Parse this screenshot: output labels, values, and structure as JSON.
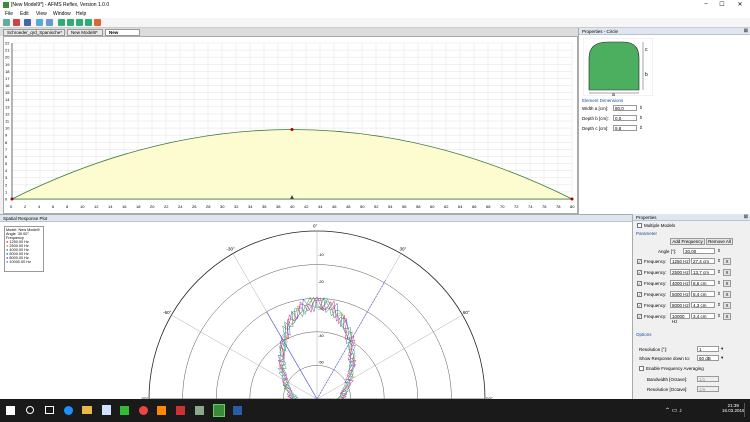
{
  "window": {
    "title": "[New Model9*] - AFMS Reflex, Version 1.0.0",
    "min": "–",
    "max": "☐",
    "close": "✕"
  },
  "menu": [
    "File",
    "Edit",
    "View",
    "Window",
    "Help"
  ],
  "tabs": [
    {
      "label": "Schroeder_qrd_Spanische*"
    },
    {
      "label": "New Model8*"
    },
    {
      "label": "New Model9*",
      "active": true
    }
  ],
  "model_view": {
    "y_ticks": [
      "22",
      "21",
      "20",
      "19",
      "18",
      "17",
      "16",
      "15",
      "14",
      "13",
      "12",
      "11",
      "10",
      "9",
      "8",
      "7",
      "6",
      "5",
      "4",
      "3",
      "2",
      "1",
      "0"
    ],
    "x_ticks": [
      "0",
      "2",
      "4",
      "6",
      "8",
      "10",
      "12",
      "14",
      "16",
      "18",
      "20",
      "22",
      "24",
      "26",
      "28",
      "30",
      "32",
      "34",
      "36",
      "38",
      "40",
      "42",
      "44",
      "46",
      "48",
      "50",
      "52",
      "54",
      "56",
      "58",
      "60",
      "62",
      "64",
      "66",
      "68",
      "70",
      "72",
      "74",
      "76",
      "78",
      "80"
    ],
    "arc_color": "#3a7a3a",
    "fill_color": "#fdfcd0"
  },
  "properties": {
    "header": "Properties - Circle",
    "dims": {
      "a": "a",
      "b": "b",
      "c": "c"
    },
    "section": "Element Dimensions",
    "fields": [
      {
        "label": "Width a [cm]:",
        "value": "80,0"
      },
      {
        "label": "Depth b [cm]:",
        "value": "0,0"
      },
      {
        "label": "Depth c [cm]:",
        "value": "9,8"
      }
    ],
    "shape_color": "#4caf60"
  },
  "spatial": {
    "header": "Spatial Response Plot",
    "legend": {
      "model_label": "Model",
      "model_value": "New Model9",
      "angle_label": "Angle",
      "angle_value": "30.00°",
      "freq_label": "Frequency",
      "items": [
        {
          "label": "1250.00 Hz",
          "color": "#e03030"
        },
        {
          "label": "2500.00 Hz",
          "color": "#e08030"
        },
        {
          "label": "4000.00 Hz",
          "color": "#30a030"
        },
        {
          "label": "5000.00 Hz",
          "color": "#3060e0"
        },
        {
          "label": "8000.00 Hz",
          "color": "#a030c0"
        },
        {
          "label": "10000.00 Hz",
          "color": "#20a0a0"
        }
      ]
    },
    "angles": {
      "a0": "0°",
      "a30l": "-30°",
      "a30r": "30°",
      "a60l": "-60°",
      "a60r": "60°",
      "a90l": "-90°",
      "a90r": "90°"
    },
    "db": [
      "-10",
      "-20",
      "-30",
      "-40",
      "-50"
    ]
  },
  "spprops": {
    "header": "Properties",
    "multiple_models": "Multiple Models",
    "parameter": "Parameter",
    "add_frequency": "Add Frequency",
    "remove_all": "Remove All",
    "angle_label": "Angle [°]:",
    "angle_value": "30,00",
    "freq_label": "Frequency:",
    "remove_x": "X",
    "frequencies": [
      {
        "hz": "1250 Hz",
        "cm": "27,4 cm"
      },
      {
        "hz": "2500 Hz",
        "cm": "13,7 cm"
      },
      {
        "hz": "4000 Hz",
        "cm": "8,6 cm"
      },
      {
        "hz": "5000 Hz",
        "cm": "5,4 cm"
      },
      {
        "hz": "8000 Hz",
        "cm": "4,3 cm"
      },
      {
        "hz": "10000 Hz",
        "cm": "3,4 cm"
      }
    ],
    "options": "Options",
    "resolution_label": "Resolution [°]:",
    "resolution_value": "1",
    "show_response_label": "Show Response down to:",
    "show_response_value": "60 dB",
    "enable_averaging": "Enable Frequency Averaging",
    "bandwidth_label": "Bandwidth [Octave]:",
    "bandwidth_value": "1/1",
    "avg_resolution_label": "Resolution [Octave]:",
    "avg_resolution_value": "1/6"
  },
  "taskbar": {
    "time": "21:39",
    "date": "16.03.2016"
  }
}
